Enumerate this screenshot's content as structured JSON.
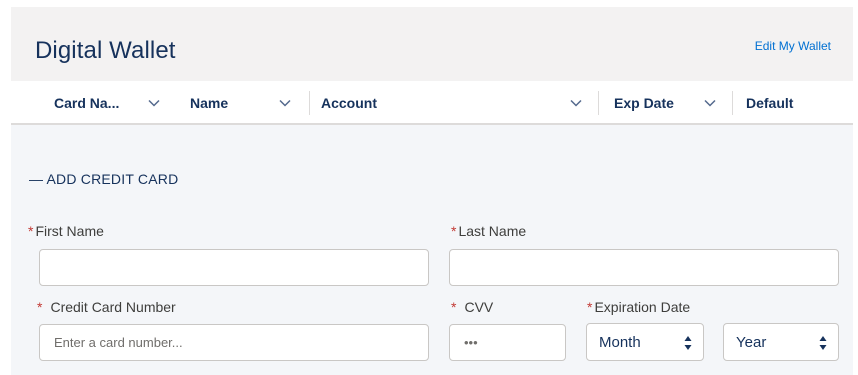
{
  "header": {
    "title": "Digital Wallet",
    "edit_link": "Edit My Wallet"
  },
  "columns": [
    {
      "label": "Card Na...",
      "icon": "chevron-down-icon"
    },
    {
      "label": "Name",
      "icon": "chevron-down-icon"
    },
    {
      "label": "Account",
      "icon": "chevron-down-icon"
    },
    {
      "label": "Exp Date",
      "icon": "chevron-down-icon"
    },
    {
      "label": "Default"
    }
  ],
  "form": {
    "section_label": "— ADD CREDIT CARD",
    "required_marker": "*",
    "first_name": {
      "label": "First Name",
      "value": "",
      "placeholder": ""
    },
    "last_name": {
      "label": "Last Name",
      "value": "",
      "placeholder": ""
    },
    "card_number": {
      "label": "Credit Card Number",
      "value": "",
      "placeholder": "Enter a card number..."
    },
    "cvv": {
      "label": "CVV",
      "value": "",
      "placeholder": "•••"
    },
    "expiration": {
      "label": "Expiration Date",
      "month": {
        "selected": "Month",
        "icon": "select-stepper-icon"
      },
      "year": {
        "selected": "Year",
        "icon": "select-stepper-icon"
      }
    }
  },
  "colors": {
    "brand_text": "#16325c",
    "link": "#0070d2",
    "required": "#c23934",
    "header_bg": "#f3f2f2",
    "body_bg": "#f4f6f9",
    "border": "#dddbda"
  }
}
